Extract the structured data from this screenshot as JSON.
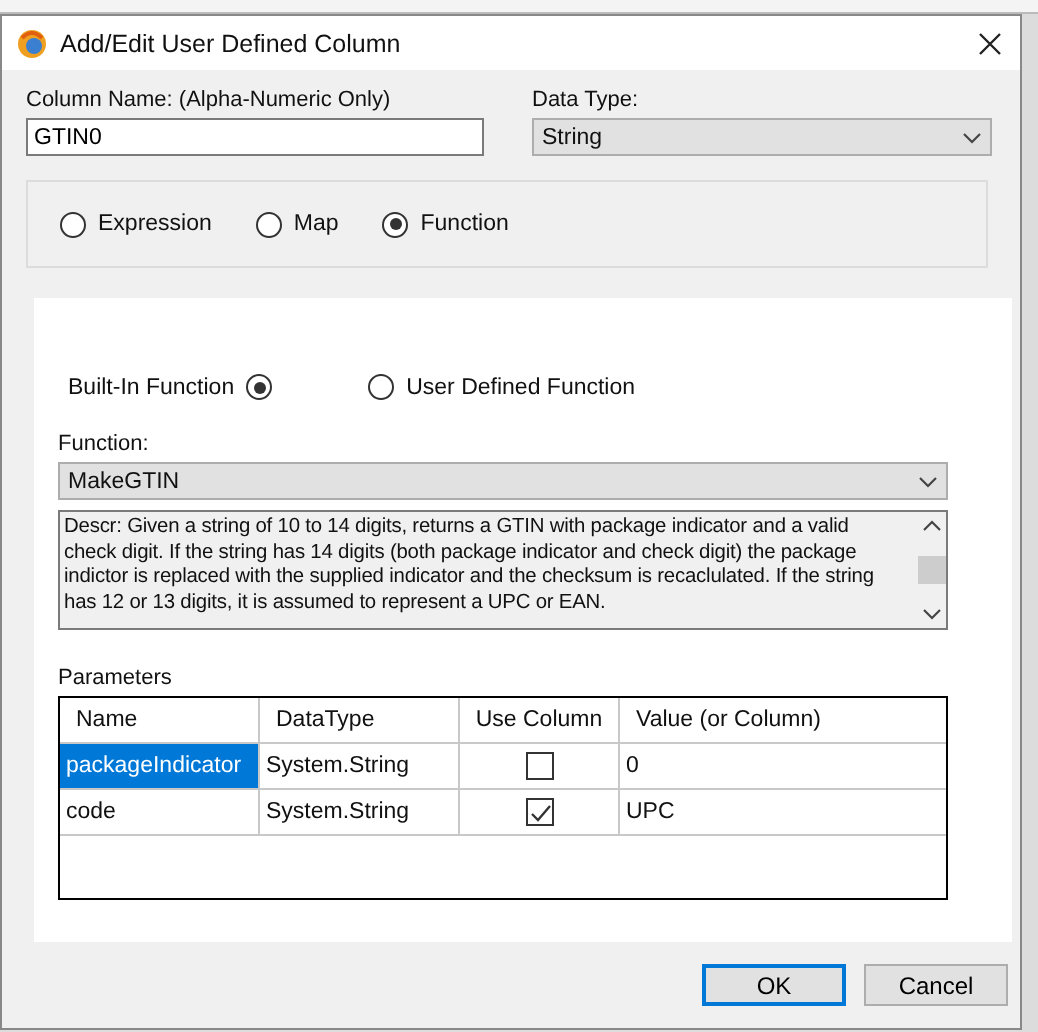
{
  "window": {
    "title": "Add/Edit User Defined Column"
  },
  "column_name": {
    "label": "Column Name:  (Alpha-Numeric Only)",
    "value": "GTIN0"
  },
  "data_type": {
    "label": "Data Type:",
    "value": "String"
  },
  "column_kind": [
    {
      "label": "Expression",
      "selected": false
    },
    {
      "label": "Map",
      "selected": false
    },
    {
      "label": "Function",
      "selected": true
    }
  ],
  "function_source": [
    {
      "label": "Built-In Function",
      "selected": true
    },
    {
      "label": "User Defined Function",
      "selected": false
    }
  ],
  "function": {
    "label": "Function:",
    "value": "MakeGTIN"
  },
  "description": "Descr: Given a string of 10 to 14 digits, returns a GTIN with package indicator and a valid check digit. If the string has 14 digits (both package indicator and check digit) the package indictor is replaced with the supplied indicator and the checksum is recaclulated. If the string has 12 or 13 digits, it is assumed to represent a UPC or EAN.",
  "parameters": {
    "label": "Parameters",
    "columns": [
      "Name",
      "DataType",
      "Use Column",
      "Value (or Column)"
    ],
    "rows": [
      {
        "name": "packageIndicator",
        "selected": true,
        "data_type": "System.String",
        "use_column": false,
        "value": "0"
      },
      {
        "name": "code",
        "selected": false,
        "data_type": "System.String",
        "use_column": true,
        "value": "UPC"
      }
    ]
  },
  "buttons": [
    {
      "label": "OK",
      "default": true
    },
    {
      "label": "Cancel",
      "default": false
    }
  ]
}
